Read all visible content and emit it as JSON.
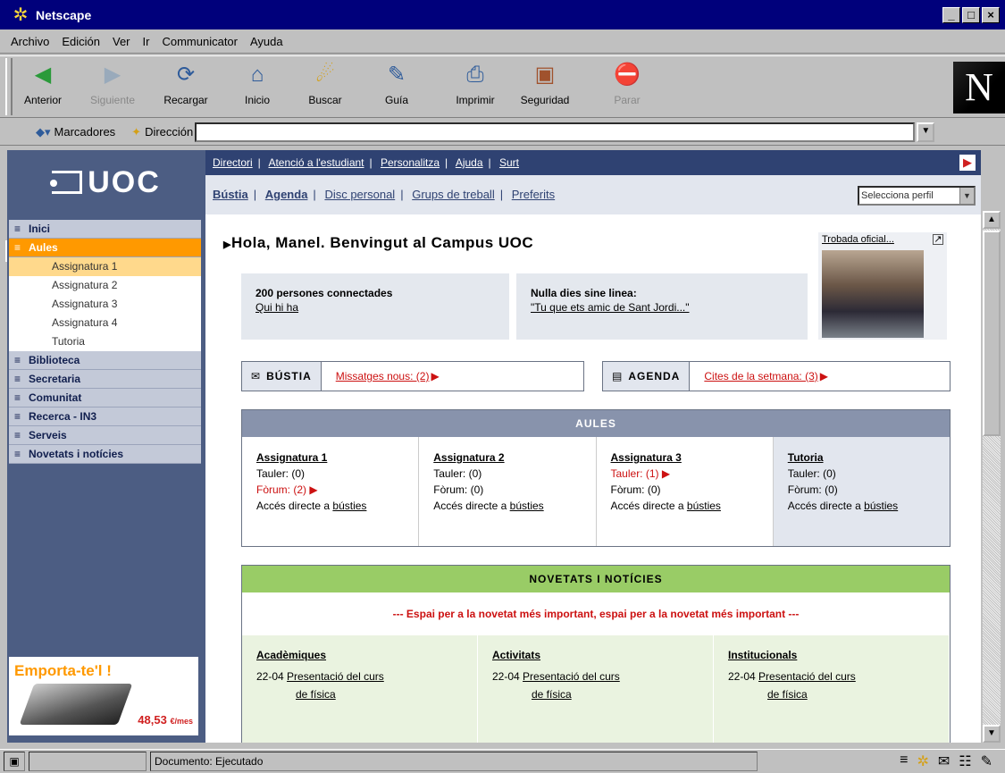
{
  "window": {
    "title": "Netscape",
    "controls": [
      "_",
      "□",
      "×"
    ]
  },
  "menubar": [
    "Archivo",
    "Edición",
    "Ver",
    "Ir",
    "Communicator",
    "Ayuda"
  ],
  "toolbar": {
    "buttons": [
      {
        "label": "Anterior",
        "icon": "back-icon",
        "glyph": "◀",
        "enabled": true
      },
      {
        "label": "Siguiente",
        "icon": "forward-icon",
        "glyph": "▶",
        "enabled": false
      },
      {
        "label": "Recargar",
        "icon": "reload-icon",
        "glyph": "⟳",
        "enabled": true
      },
      {
        "label": "Inicio",
        "icon": "home-icon",
        "glyph": "⌂",
        "enabled": true
      },
      {
        "label": "Buscar",
        "icon": "search-icon",
        "glyph": "☄",
        "enabled": true
      },
      {
        "label": "Guía",
        "icon": "guide-icon",
        "glyph": "✎",
        "enabled": true
      },
      {
        "label": "Imprimir",
        "icon": "print-icon",
        "glyph": "⎙",
        "enabled": true
      },
      {
        "label": "Seguridad",
        "icon": "security-icon",
        "glyph": "🔒",
        "enabled": true
      },
      {
        "label": "Parar",
        "icon": "stop-icon",
        "glyph": "⛔",
        "enabled": false
      }
    ],
    "logo": "N"
  },
  "locationbar": {
    "bookmarks": "Marcadores",
    "direccion": "Dirección",
    "url": ""
  },
  "uoc": {
    "logo": "UOC",
    "toplinks": [
      "Directori",
      "Atenció a l'estudiant",
      "Personalitza",
      "Ajuda",
      "Surt"
    ],
    "tabs": [
      "Bústia",
      "Agenda",
      "Disc personal",
      "Grups de treball",
      "Preferits"
    ],
    "profile_select": "Selecciona perfil",
    "menu": [
      {
        "label": "Inici",
        "type": "main"
      },
      {
        "label": "Aules",
        "type": "active"
      },
      {
        "label": "Assignatura 1",
        "type": "subsel"
      },
      {
        "label": "Assignatura 2",
        "type": "sub"
      },
      {
        "label": "Assignatura 3",
        "type": "sub"
      },
      {
        "label": "Assignatura 4",
        "type": "sub"
      },
      {
        "label": "Tutoria",
        "type": "sub"
      },
      {
        "label": "Biblioteca",
        "type": "main"
      },
      {
        "label": "Secretaria",
        "type": "main"
      },
      {
        "label": "Comunitat",
        "type": "main"
      },
      {
        "label": "Recerca - IN3",
        "type": "main"
      },
      {
        "label": "Serveis",
        "type": "main"
      },
      {
        "label": "Novetats i notícies",
        "type": "main"
      }
    ],
    "promo": {
      "title": "Emporta-te'l !",
      "price": "48,53",
      "unit": "€/mes"
    },
    "greeting": "Hola, Manel. Benvingut al Campus UOC",
    "photo_caption": "Trobada oficial...",
    "connected": {
      "title": "200 persones connectades",
      "link": "Qui hi ha"
    },
    "motto": {
      "title": "Nulla dies sine linea:",
      "link": "\"Tu que ets amic de Sant Jordi...\""
    },
    "bustia": {
      "label": "BÚSTIA",
      "link": "Missatges nous: (2)"
    },
    "agenda": {
      "label": "AGENDA",
      "link": "Cites de la setmana: (3)"
    },
    "aules": {
      "header": "AULES",
      "cols": [
        {
          "title": "Assignatura 1",
          "tauler": "Tauler: (0)",
          "forum": "Fòrum: (2)",
          "forum_new": true,
          "tauler_new": false,
          "acces": "Accés directe a",
          "link": "bústies"
        },
        {
          "title": "Assignatura 2",
          "tauler": "Tauler: (0)",
          "forum": "Fòrum: (0)",
          "forum_new": false,
          "tauler_new": false,
          "acces": "Accés directe a",
          "link": "bústies"
        },
        {
          "title": "Assignatura 3",
          "tauler": "Tauler: (1)",
          "forum": "Fòrum: (0)",
          "forum_new": false,
          "tauler_new": true,
          "acces": "Accés directe a",
          "link": "bústies"
        },
        {
          "title": "Tutoria",
          "tauler": "Tauler: (0)",
          "forum": "Fòrum: (0)",
          "forum_new": false,
          "tauler_new": false,
          "acces": "Accés directe a",
          "link": "bústies"
        }
      ]
    },
    "novetats": {
      "header": "NOVETATS I NOTÍCIES",
      "featured": "--- Espai per a la novetat més important, espai per a la novetat més important ---",
      "cols": [
        {
          "title": "Acadèmiques",
          "date": "22-04",
          "line1": "Presentació del curs",
          "line2": "de física"
        },
        {
          "title": "Activitats",
          "date": "22-04",
          "line1": "Presentació del curs",
          "line2": "de física"
        },
        {
          "title": "Institucionals",
          "date": "22-04",
          "line1": "Presentació del curs",
          "line2": "de física"
        }
      ]
    }
  },
  "statusbar": {
    "text": "Documento: Ejecutado"
  }
}
